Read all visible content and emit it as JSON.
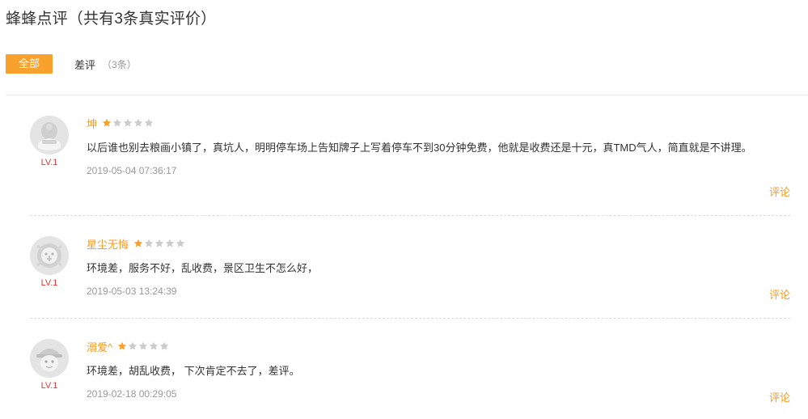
{
  "header": {
    "title": "蜂蜂点评（共有3条真实评价）"
  },
  "tabs": {
    "all_label": "全部",
    "bad_label": "差评",
    "bad_count": "（3条）"
  },
  "colors": {
    "accent": "#f8a12d",
    "username": "#f59a23",
    "level": "#e4393c",
    "star_on": "#f8a12d",
    "star_off": "#cccccc"
  },
  "reviews": [
    {
      "username": "坤",
      "level": "LV.1",
      "rating": 1,
      "max_rating": 5,
      "text": "以后谁也别去粮画小镇了，真坑人，明明停车场上告知牌子上写着停车不到30分钟免费，他就是收费还是十元，真TMD气人，简直就是不讲理。",
      "date": "2019-05-04 07:36:17",
      "comment_label": "评论"
    },
    {
      "username": "星尘无悔",
      "level": "LV.1",
      "rating": 1,
      "max_rating": 5,
      "text": "环境差，服务不好，乱收费，景区卫生不怎么好，",
      "date": "2019-05-03 13:24:39",
      "comment_label": "评论"
    },
    {
      "username": "溺爱^",
      "level": "LV.1",
      "rating": 1,
      "max_rating": 5,
      "text": "环境差，胡乱收费， 下次肯定不去了，差评。",
      "date": "2019-02-18 00:29:05",
      "comment_label": "评论"
    }
  ]
}
